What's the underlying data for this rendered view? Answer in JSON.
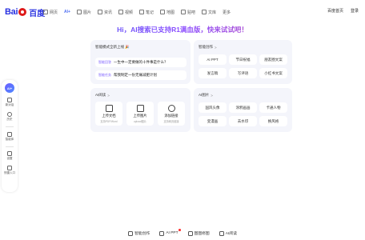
{
  "logo": {
    "brand_left": "Bai",
    "brand_right": "百度"
  },
  "nav": [
    {
      "label": "网页",
      "icon": "search-icon",
      "active": false
    },
    {
      "label": "AI+",
      "icon": "ai-icon",
      "active": true
    },
    {
      "label": "图片",
      "icon": "image-icon",
      "active": false
    },
    {
      "label": "资讯",
      "icon": "news-icon",
      "active": false
    },
    {
      "label": "视频",
      "icon": "video-icon",
      "active": false
    },
    {
      "label": "笔记",
      "icon": "note-icon",
      "active": false
    },
    {
      "label": "地图",
      "icon": "map-icon",
      "active": false
    },
    {
      "label": "贴吧",
      "icon": "tieba-icon",
      "active": false
    },
    {
      "label": "文库",
      "icon": "wenku-icon",
      "active": false
    },
    {
      "label": "更多",
      "icon": "more-icon",
      "active": false
    }
  ],
  "top_right": {
    "home": "百度首页",
    "login": "登录"
  },
  "rail": {
    "ai_badge": "AI+",
    "items": [
      {
        "label": "新对话",
        "icon": "new-chat-icon"
      },
      {
        "label": "历史",
        "icon": "history-icon"
      },
      {
        "label": "智能体",
        "icon": "agent-icon"
      },
      {
        "label": "设置",
        "icon": "settings-icon"
      },
      {
        "label": "快捷入口",
        "icon": "shortcut-icon"
      }
    ]
  },
  "headline": "Hi，AI搜索已支持R1满血版，快来试试吧！",
  "mode_card": {
    "title": "智能模式全新上线 🎉",
    "rows": [
      {
        "tag": "智能回答",
        "text": "一生中一定要做的十件事是什么？"
      },
      {
        "tag": "智能任务",
        "text": "帮我制定一份无痛减肥计划"
      }
    ]
  },
  "create_card": {
    "title": "智能创作",
    "arrow": ">",
    "chips": [
      "AI PPT",
      "节日祝福",
      "朋友圈文案",
      "发言稿",
      "写评语",
      "小红书文案"
    ]
  },
  "read_card": {
    "title": "AI阅读",
    "arrow": ">",
    "tiles": [
      {
        "label": "上传文档",
        "sub": "支持PDF/Word",
        "icon": "folder-icon"
      },
      {
        "label": "上传图片",
        "sub": "upload图片",
        "icon": "image-upload-icon"
      },
      {
        "label": "添加链接",
        "sub": "支持网页链接",
        "icon": "globe-icon"
      }
    ]
  },
  "image_card": {
    "title": "AI图片",
    "arrow": ">",
    "chips": [
      "国风头像",
      "涂鸦画画",
      "卡通人物",
      "变漫画",
      "去水印",
      "换风格"
    ]
  },
  "bottom": [
    {
      "label": "智能创作",
      "icon": "pen-icon",
      "dot": false
    },
    {
      "label": "AI PPT",
      "icon": "ppt-icon",
      "dot": true
    },
    {
      "label": "图图修图",
      "icon": "photo-edit-icon",
      "dot": false
    },
    {
      "label": "AI阅读",
      "icon": "read-icon",
      "dot": false
    }
  ]
}
